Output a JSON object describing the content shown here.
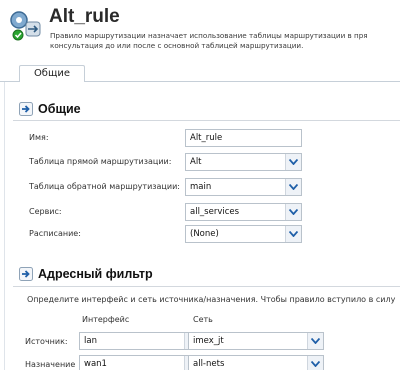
{
  "header": {
    "title": "Alt_rule",
    "description_line1": "Правило маршрутизации назначает использование таблицы маршрутизации в пря",
    "description_line2": "консультация до или после с основной таблицей маршрутизации."
  },
  "tabs": [
    {
      "label": "Общие"
    }
  ],
  "general": {
    "section_title": "Общие",
    "name_label": "Имя:",
    "name_value": "Alt_rule",
    "forward_table_label": "Таблица прямой маршрутизации:",
    "forward_table_value": "Alt",
    "reverse_table_label": "Таблица обратной маршрутизации:",
    "reverse_table_value": "main",
    "service_label": "Сервис:",
    "service_value": "all_services",
    "schedule_label": "Расписание:",
    "schedule_value": "(None)"
  },
  "address_filter": {
    "section_title": "Адресный фильтр",
    "info": "Определите интерфейс и сеть источника/назначения. Чтобы правило вступило в силу",
    "col_interface": "Интерфейс",
    "col_network": "Сеть",
    "source_label": "Источник:",
    "source_interface": "lan",
    "source_network": "imex_jt",
    "dest_label": "Назначение",
    "dest_interface": "wan1",
    "dest_network": "all-nets"
  },
  "icons": {
    "header": "routing-rule-icon",
    "section": "section-arrow-icon",
    "dropdown": "chevron-down-icon"
  },
  "colors": {
    "accent": "#1f5fa8",
    "border": "#b9c2cb"
  }
}
